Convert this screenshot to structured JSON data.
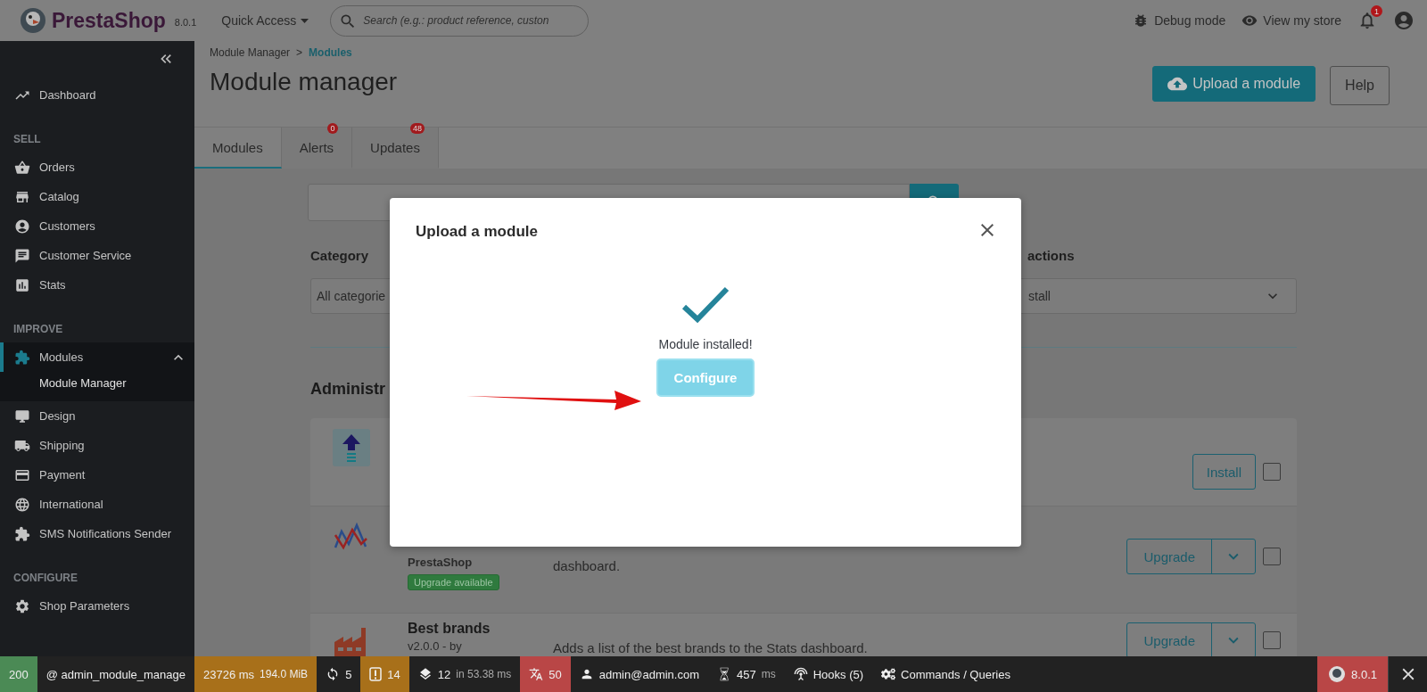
{
  "header": {
    "logo": "PrestaShop",
    "version": "8.0.1",
    "quick_access": "Quick Access",
    "search": {
      "placeholder": "Search (e.g.: product reference, custon"
    },
    "links": [
      {
        "kind": "debug",
        "label": "Debug mode"
      },
      {
        "kind": "store",
        "label": "View my store"
      }
    ],
    "notifications": "1"
  },
  "sidebar": {
    "items": [
      {
        "kind": "link",
        "label": "Dashboard",
        "selected": false
      },
      {
        "kind": "heading",
        "label": "SELL"
      },
      {
        "kind": "link",
        "label": "Orders",
        "selected": false
      },
      {
        "kind": "link",
        "label": "Catalog",
        "selected": false
      },
      {
        "kind": "link",
        "label": "Customers",
        "selected": false
      },
      {
        "kind": "link",
        "label": "Customer Service",
        "selected": false
      },
      {
        "kind": "link",
        "label": "Stats",
        "selected": false
      },
      {
        "kind": "heading",
        "label": "IMPROVE"
      },
      {
        "kind": "link",
        "label": "Modules",
        "selected": true,
        "expanded": true,
        "children": [
          {
            "label": "Module Manager",
            "selected": true
          }
        ]
      },
      {
        "kind": "link",
        "label": "Design",
        "selected": false
      },
      {
        "kind": "link",
        "label": "Shipping",
        "selected": false
      },
      {
        "kind": "link",
        "label": "Payment",
        "selected": false
      },
      {
        "kind": "link",
        "label": "International",
        "selected": false
      },
      {
        "kind": "link",
        "label": "SMS Notifications Sender",
        "selected": false
      },
      {
        "kind": "heading",
        "label": "CONFIGURE"
      },
      {
        "kind": "link",
        "label": "Shop Parameters",
        "selected": false
      }
    ]
  },
  "breadcrumb": {
    "items": [
      "Module Manager",
      "Modules"
    ],
    "separator": ">"
  },
  "page_title": "Module manager",
  "toolbar": [
    {
      "kind": "primary",
      "label": "Upload a module"
    },
    {
      "kind": "outline",
      "label": "Help"
    }
  ],
  "tabs": [
    {
      "label": "Modules",
      "selected": true
    },
    {
      "label": "Alerts",
      "badge": "0",
      "selected": false
    },
    {
      "label": "Updates",
      "badge": "48",
      "selected": false
    }
  ],
  "filters": {
    "category_label": "Category",
    "category_value": "All categorie",
    "actions_label": "actions",
    "actions_value": "stall"
  },
  "section_title": "Administr",
  "modules": [
    {
      "kind": "upload",
      "action": {
        "kind": "single",
        "label": "Install"
      },
      "checked": false
    },
    {
      "kind": "chart",
      "author": "PrestaShop",
      "badge": "Upgrade available",
      "description": "dashboard.",
      "action": {
        "kind": "split",
        "label": "Upgrade"
      },
      "checked": false
    },
    {
      "kind": "factory",
      "name": "Best brands",
      "version": "v2.0.0 - by",
      "description": "Adds a list of the best brands to the Stats dashboard.",
      "action": {
        "kind": "split",
        "label": "Upgrade"
      },
      "checked": false
    }
  ],
  "modal": {
    "title": "Upload a module",
    "message": "Module installed!",
    "button": "Configure"
  },
  "debug_bar": {
    "items": [
      {
        "kind": "status",
        "value": "200",
        "color": "#4b8a55"
      },
      {
        "kind": "route",
        "value": "@ admin_module_manage"
      },
      {
        "kind": "time",
        "value": "23726 ms",
        "extra": "194.0 MiB",
        "color": "#a8701a"
      },
      {
        "kind": "ajax",
        "value": "5"
      },
      {
        "kind": "errors",
        "value": "14",
        "color": "#a8701a"
      },
      {
        "kind": "db",
        "value": "12",
        "extra": "in 53.38 ms"
      },
      {
        "kind": "translations",
        "value": "50",
        "color": "#b94646"
      },
      {
        "kind": "user",
        "value": "admin@admin.com"
      },
      {
        "kind": "perf",
        "value": "457",
        "extra": "ms"
      },
      {
        "kind": "hooks",
        "value": "Hooks (5)"
      },
      {
        "kind": "commands",
        "value": "Commands / Queries"
      }
    ],
    "version": {
      "value": "8.0.1",
      "color": "#b94646"
    }
  }
}
